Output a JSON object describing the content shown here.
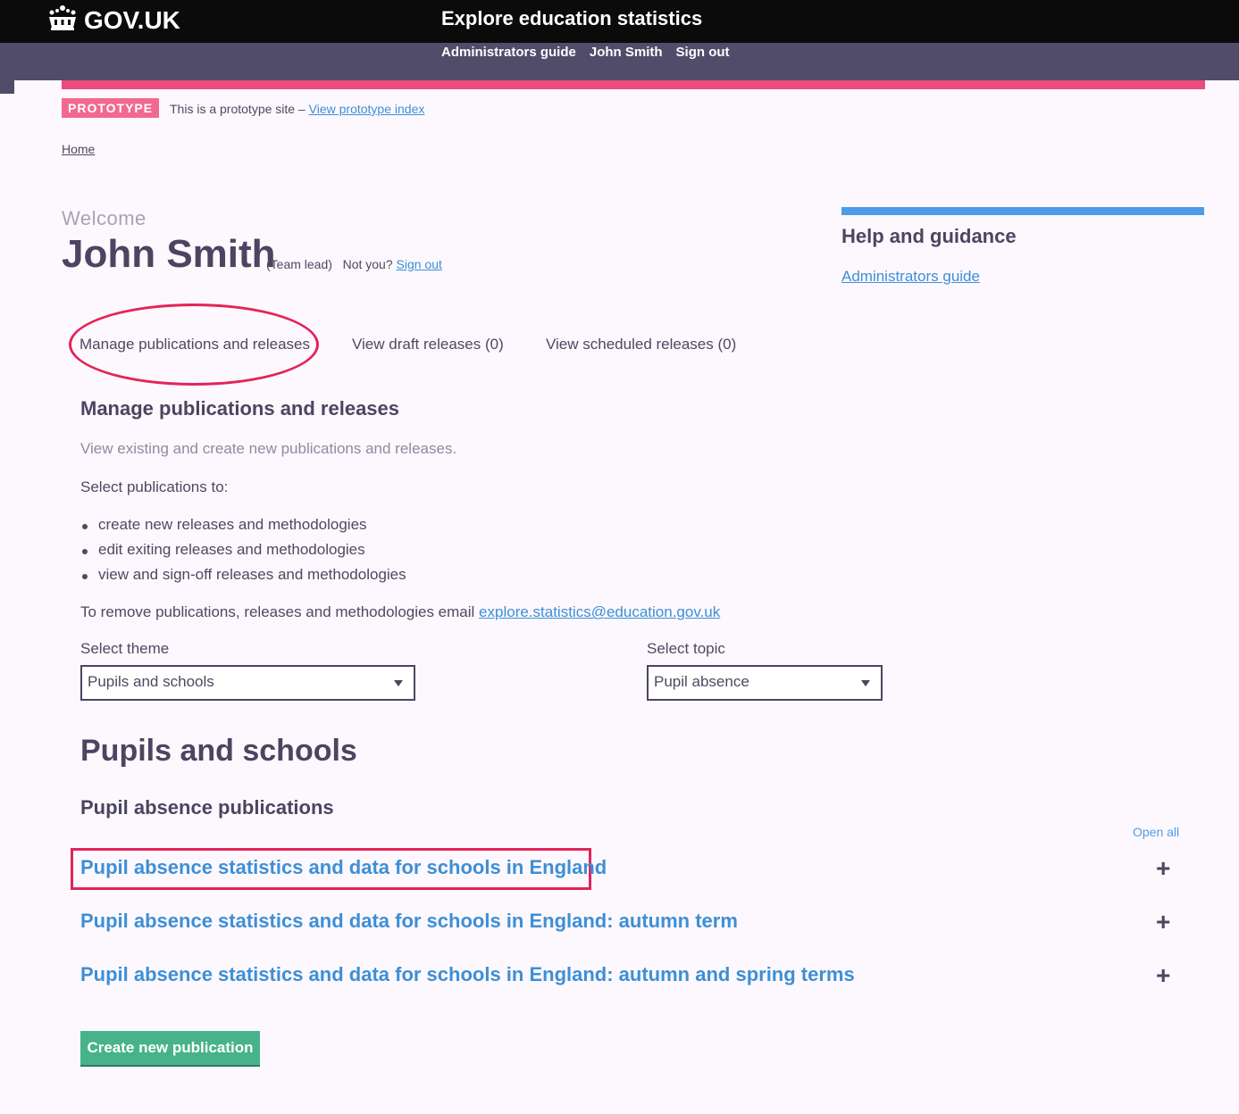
{
  "header": {
    "logo_text": "GOV.UK",
    "service_name": "Explore education statistics",
    "nav": [
      "Administrators guide",
      "John Smith",
      "Sign out"
    ]
  },
  "banner": {
    "tag": "PROTOTYPE",
    "text": "This is a prototype site –",
    "link": "View prototype index"
  },
  "breadcrumb": {
    "home": "Home"
  },
  "user": {
    "welcome": "Welcome",
    "name": "John Smith",
    "role": "(Team lead)",
    "not_you": "Not you?",
    "sign_out": "Sign out"
  },
  "help": {
    "title": "Help and guidance",
    "link": "Administrators guide"
  },
  "tabs": [
    "Manage publications and releases",
    "View draft releases (0)",
    "View scheduled releases (0)"
  ],
  "manage": {
    "heading": "Manage publications and releases",
    "lead": "View existing and create new publications and releases.",
    "select_intro": "Select publications to:",
    "bullets": [
      "create new releases and methodologies",
      "edit exiting releases and methodologies",
      "view and sign-off releases and methodologies"
    ],
    "remove_text": "To remove publications, releases and methodologies email",
    "email": "explore.statistics@education.gov.uk"
  },
  "filters": {
    "theme_label": "Select theme",
    "theme_value": "Pupils and schools",
    "topic_label": "Select topic",
    "topic_value": "Pupil absence"
  },
  "theme_heading": "Pupils and schools",
  "topic_heading": "Pupil absence publications",
  "open_all": "Open all",
  "publications": [
    "Pupil absence statistics and data for schools in England",
    "Pupil absence statistics and data for schools in England: autumn term",
    "Pupil absence statistics and data for schools in England: autumn and spring terms"
  ],
  "plus_glyph": "+",
  "create_button": "Create new publication",
  "colors": {
    "accent_pink": "#ec4b7c",
    "highlight_red": "#e3245a",
    "link_blue": "#3d8fd6",
    "help_bar_blue": "#4b9ce7",
    "button_green": "#46b38a",
    "header_dark": "#0b0b0c",
    "subbar_purple": "#514c6a"
  }
}
